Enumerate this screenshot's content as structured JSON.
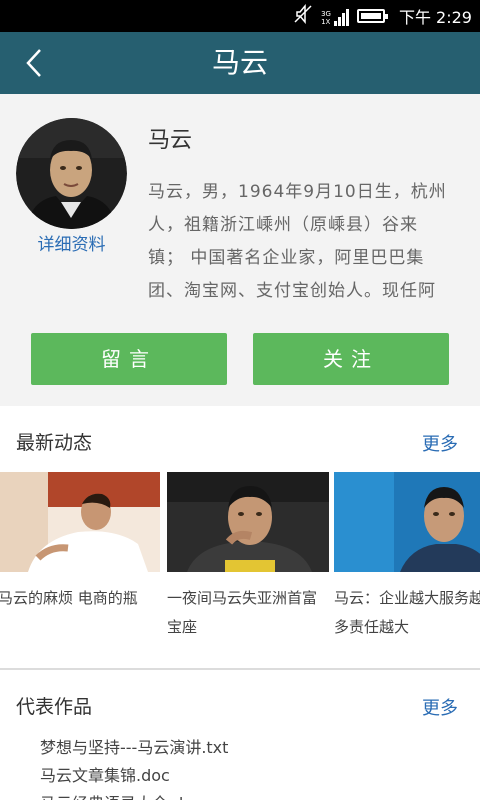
{
  "status_bar": {
    "network_top": "3G",
    "network_bottom": "1X",
    "time": "下午 2:29",
    "icons": [
      "muted-icon",
      "signal-icon",
      "battery-icon"
    ]
  },
  "nav": {
    "title": "马云",
    "back_icon": "chevron-left-icon"
  },
  "profile": {
    "name": "马云",
    "detail_link": "详细资料",
    "bio": "马云，男，1964年9月10日生，杭州人，祖籍浙江嵊州（原嵊县）谷来镇； 中国著名企业家，阿里巴巴集团、淘宝网、支付宝创始人。现任阿",
    "message_button": "留言",
    "follow_button": "关注"
  },
  "news": {
    "title": "最新动态",
    "more": "更多",
    "items": [
      {
        "caption": "马云的麻烦 电商的瓶"
      },
      {
        "caption": "一夜间马云失亚洲首富宝座"
      },
      {
        "caption": "马云：企业越大服务越多责任越大"
      }
    ]
  },
  "works": {
    "title": "代表作品",
    "more": "更多",
    "items": [
      "梦想与坚持---马云演讲.txt",
      "马云文章集锦.doc",
      "马云经典语录大全.doc"
    ]
  },
  "colors": {
    "nav_bg": "#265f70",
    "button_green": "#5cb85c",
    "link_blue": "#2a6cb4",
    "profile_bg": "#f3f3f3"
  }
}
